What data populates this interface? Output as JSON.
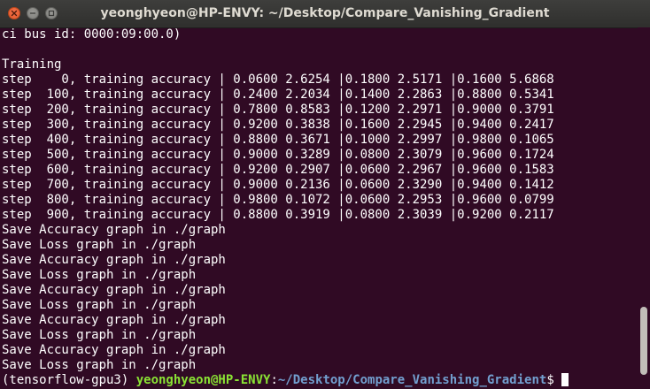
{
  "window": {
    "title": "yeonghyeon@HP-ENVY: ~/Desktop/Compare_Vanishing_Gradient"
  },
  "terminal": {
    "lines": [
      "ci bus id: 0000:09:00.0)",
      "",
      "Training",
      "step    0, training accuracy | 0.0600 2.6254 |0.1800 2.5171 |0.1600 5.6868",
      "step  100, training accuracy | 0.2400 2.2034 |0.1400 2.2863 |0.8800 0.5341",
      "step  200, training accuracy | 0.7800 0.8583 |0.1200 2.2971 |0.9000 0.3791",
      "step  300, training accuracy | 0.9200 0.3838 |0.1600 2.2945 |0.9400 0.2417",
      "step  400, training accuracy | 0.8800 0.3671 |0.1000 2.2997 |0.9800 0.1065",
      "step  500, training accuracy | 0.9000 0.3289 |0.0800 2.3079 |0.9600 0.1724",
      "step  600, training accuracy | 0.9200 0.2907 |0.0600 2.2967 |0.9600 0.1583",
      "step  700, training accuracy | 0.9000 0.2136 |0.0600 2.3290 |0.9400 0.1412",
      "step  800, training accuracy | 0.9800 0.1072 |0.0600 2.2953 |0.9600 0.0799",
      "step  900, training accuracy | 0.8800 0.3919 |0.0800 2.3039 |0.9200 0.2117",
      "Save Accuracy graph in ./graph",
      "Save Loss graph in ./graph",
      "Save Accuracy graph in ./graph",
      "Save Loss graph in ./graph",
      "Save Accuracy graph in ./graph",
      "Save Loss graph in ./graph",
      "Save Accuracy graph in ./graph",
      "Save Loss graph in ./graph",
      "Save Accuracy graph in ./graph",
      "Save Loss graph in ./graph"
    ],
    "prompt": {
      "env": "(tensorflow-gpu3) ",
      "user_host": "yeonghyeon@HP-ENVY",
      "separator": ":",
      "path": "~/Desktop/Compare_Vanishing_Gradient",
      "symbol": "$ "
    }
  },
  "icons": {
    "close": "close-icon",
    "minimize": "minimize-icon",
    "maximize": "maximize-icon"
  },
  "colors": {
    "background": "#300a24",
    "text": "#ffffff",
    "prompt_user": "#8ae234",
    "prompt_path": "#729fcf",
    "close_button": "#e95420"
  }
}
